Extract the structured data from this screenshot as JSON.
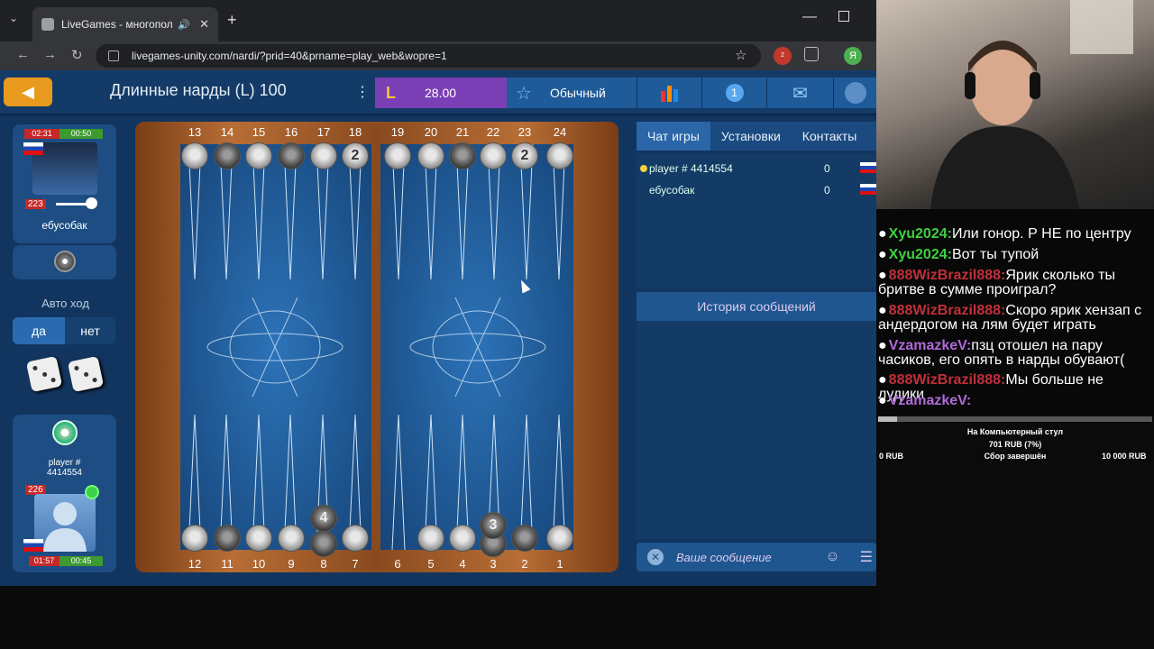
{
  "browser": {
    "tab_title": "LiveGames - многопользов",
    "url": "livegames-unity.com/nardi/?prid=40&prname=play_web&wopre=1",
    "ext_badge": "2",
    "profile_letter": "Я"
  },
  "game": {
    "title": "Длинные нарды (L) 100",
    "coins": "28.00",
    "mode": "Обычный",
    "notif_count": "1",
    "auto_label": "Авто ход",
    "yes": "да",
    "no": "нет"
  },
  "opponent": {
    "timer_total": "02:31",
    "timer_move": "00:50",
    "rating": "223",
    "name": "ебусобак"
  },
  "me": {
    "name": "player #\n4414554",
    "rating": "226",
    "timer_total": "01:57",
    "timer_move": "00:45"
  },
  "board": {
    "top_points": [
      "13",
      "14",
      "15",
      "16",
      "17",
      "18",
      "19",
      "20",
      "21",
      "22",
      "23",
      "24"
    ],
    "bottom_points": [
      "12",
      "11",
      "10",
      "9",
      "8",
      "7",
      "6",
      "5",
      "4",
      "3",
      "2",
      "1"
    ],
    "stack_labels": {
      "p18": "2",
      "p23": "2",
      "p8": "4",
      "p3": "3"
    }
  },
  "right_panel": {
    "tabs": [
      "Чат игры",
      "Установки",
      "Контакты"
    ],
    "players": [
      {
        "name": "player # 4414554",
        "score": "0"
      },
      {
        "name": "ебусобак",
        "score": "0"
      }
    ],
    "history_label": "История сообщений",
    "message_placeholder": "Ваше сообщение"
  },
  "stream_chat": [
    {
      "user": "Xyu2024:",
      "text": "Или гонор. Р НЕ по центру",
      "color": "#3cd13c"
    },
    {
      "user": "Xyu2024:",
      "text": "Вот ты тупой",
      "color": "#3cd13c"
    },
    {
      "user": "888WizBrazil888:",
      "text": "Ярик сколько ты бритве в сумме проиграл?",
      "color": "#c0303a"
    },
    {
      "user": "888WizBrazil888:",
      "text": "Скоро ярик хензап с андердогом на лям будет играть",
      "color": "#c0303a"
    },
    {
      "user": "VzamazkeV:",
      "text": "пзц отошел на пару часиков, его опять в нарды обувают(",
      "color": "#b06ad8"
    },
    {
      "user": "888WizBrazil888:",
      "text": "Мы больше не лудики",
      "color": "#c0303a"
    },
    {
      "user": "VzamazkeV:",
      "text": "",
      "color": "#b06ad8"
    }
  ],
  "donation_goal": {
    "title": "На Компьютерный стул",
    "amount": "701 RUB (7%)",
    "min": "0 RUB",
    "status": "Сбор завершён",
    "max": "10 000 RUB",
    "progress_percent": 7
  }
}
